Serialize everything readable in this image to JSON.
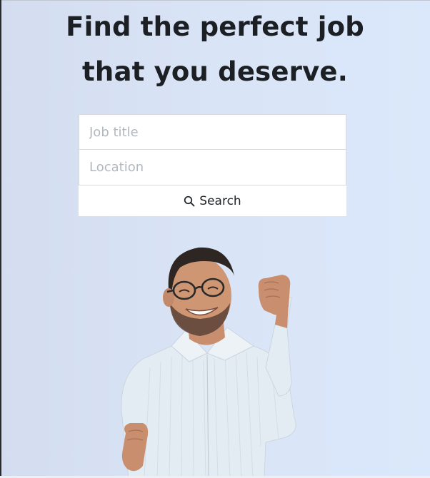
{
  "hero": {
    "headline_line1": "Find the perfect job",
    "headline_line2": "that you deserve."
  },
  "search_form": {
    "job_title_placeholder": "Job title",
    "location_placeholder": "Location",
    "search_label": "Search",
    "search_icon": "search-icon"
  },
  "image": {
    "subject": "smiling man with glasses, fist raised"
  },
  "colors": {
    "background_left": "#d3ddef",
    "background_right": "#dbe8fb",
    "text": "#1c1f23",
    "field_bg": "#ffffff",
    "placeholder": "#b3b8be"
  }
}
